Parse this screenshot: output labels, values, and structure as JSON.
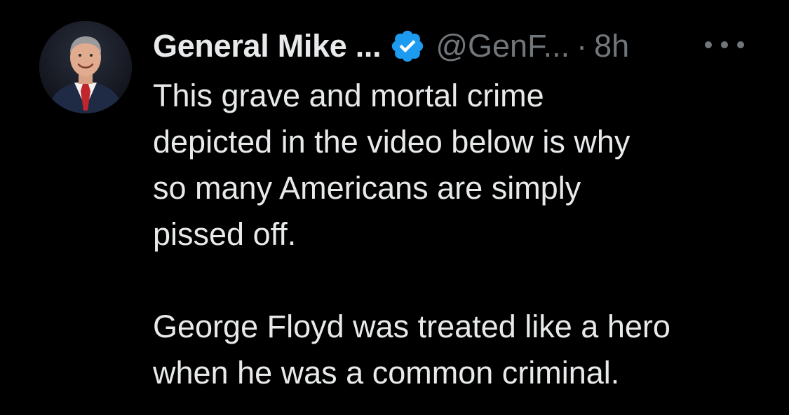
{
  "tweet": {
    "display_name": "General Mike ...",
    "handle": "@GenF...",
    "separator": "·",
    "time": "8h",
    "verified_icon": "verified-badge-icon",
    "more_icon": "more-options-icon",
    "accent_color": "#1d9bf0",
    "paragraphs": [
      {
        "lines": [
          "This grave and mortal crime",
          "depicted in the video below is why",
          "so many Americans are simply",
          "pissed off."
        ]
      },
      {
        "lines": [
          "George Floyd was treated like a hero",
          "when he was a common criminal."
        ]
      }
    ]
  }
}
